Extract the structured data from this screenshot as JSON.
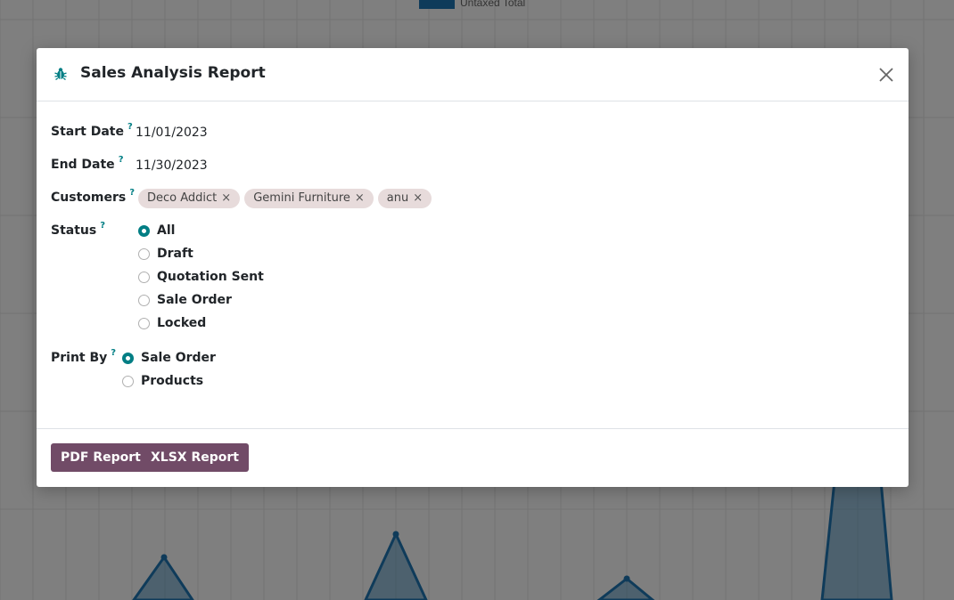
{
  "background": {
    "legend_label": "Untaxed Total",
    "series_color": "#1f77b4"
  },
  "modal": {
    "title": "Sales Analysis Report",
    "title_icon": "bug-icon",
    "close_icon": "close-icon",
    "help_marker": "?"
  },
  "fields": {
    "start_date": {
      "label": "Start Date",
      "value": "11/01/2023"
    },
    "end_date": {
      "label": "End Date",
      "value": "11/30/2023"
    },
    "customers": {
      "label": "Customers",
      "tags": [
        "Deco Addict",
        "Gemini Furniture",
        "anu"
      ],
      "remove_glyph": "×"
    },
    "status": {
      "label": "Status",
      "options": [
        "All",
        "Draft",
        "Quotation Sent",
        "Sale Order",
        "Locked"
      ],
      "selected": "All"
    },
    "print_by": {
      "label": "Print By",
      "options": [
        "Sale Order",
        "Products"
      ],
      "selected": "Sale Order"
    }
  },
  "footer": {
    "pdf_label": "PDF Report",
    "xlsx_label": "XLSX Report"
  },
  "colors": {
    "accent": "#017e84",
    "primary_button": "#714b67",
    "tag_bg": "#e7dbdb"
  }
}
